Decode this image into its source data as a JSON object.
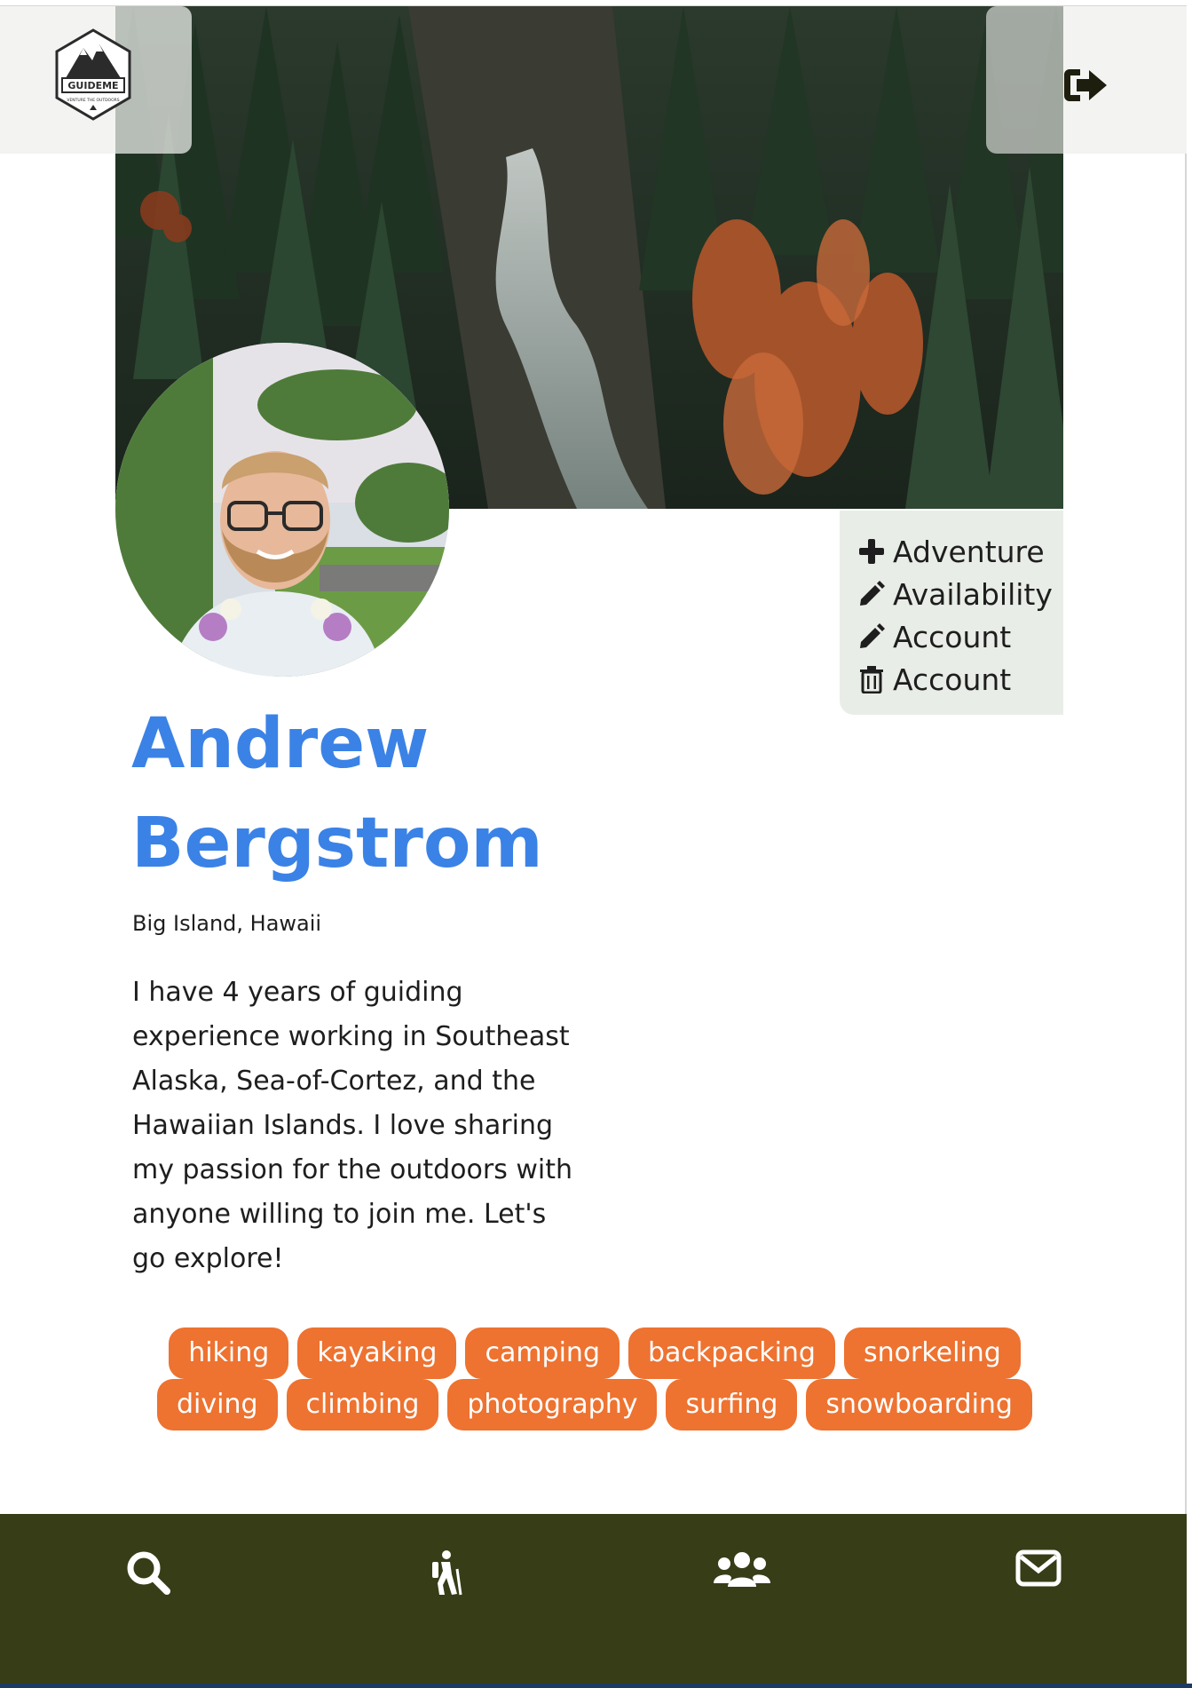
{
  "header": {
    "logo_text": "GUIDEME",
    "logo_tagline": "VENTURE THE OUTDOORS",
    "logout_icon": "sign-out-icon"
  },
  "actions": [
    {
      "icon": "plus-icon",
      "label": "Adventure"
    },
    {
      "icon": "pencil-icon",
      "label": "Availability"
    },
    {
      "icon": "pencil-icon",
      "label": "Account"
    },
    {
      "icon": "trash-icon",
      "label": "Account"
    }
  ],
  "profile": {
    "first_name": "Andrew",
    "last_name": "Bergstrom",
    "location": "Big Island, Hawaii",
    "bio": "I have 4 years of guiding experience working in Southeast Alaska, Sea-of-Cortez, and the Hawaiian Islands. I love sharing my passion for the outdoors with anyone willing to join me. Let's go explore!"
  },
  "tags": [
    [
      "hiking",
      "kayaking",
      "camping",
      "backpacking",
      "snorkeling"
    ],
    [
      "diving",
      "climbing",
      "photography",
      "surfing",
      "snowboarding"
    ]
  ],
  "bottom_nav": [
    {
      "icon": "search-icon"
    },
    {
      "icon": "hiker-icon"
    },
    {
      "icon": "users-icon"
    },
    {
      "icon": "envelope-icon"
    }
  ],
  "colors": {
    "name": "#3b82e6",
    "tag": "#ee7230",
    "nav": "#373d17",
    "panel": "#e9ede7"
  }
}
